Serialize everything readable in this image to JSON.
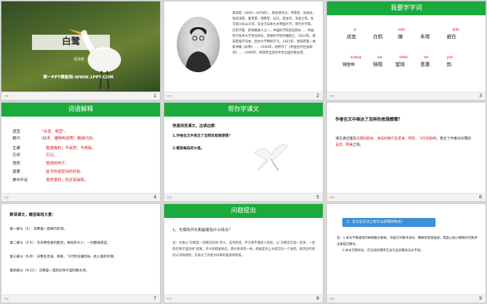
{
  "colors": {
    "accent_green": "#1daa3c",
    "red": "#d2191e",
    "blue": "#3d8fd6"
  },
  "icons": {
    "footer": "slide-play-icon",
    "s1_image": "egret-photo",
    "s2_image": "author-portrait",
    "s5_image": "flying-egret"
  },
  "slides": [
    {
      "num": "1",
      "title": "白鹭",
      "author": "郭沫若",
      "url": "第一PPT模板网-WWW.1PPT.COM"
    },
    {
      "num": "2",
      "bio": "郭沫若（1892—1978年），原名郭开贞，字鼎堂，号尚武，笔名沫若、麦克昂、郭鼎堂、石沱、高汝鸿、羊易之等。生于四川乐山沙湾，毕业于日本九州帝国大学，现代文学家、历史学家、新诗奠基人之一，中国科学院首任院长……中国科学技术大学首任校长，苏联科学院外籍院士。1914年，郭沫若留学日本，因为大学预科学习。1921年，郭沫若第一本新诗集《女神》……1930年，他所写了《中国古代社会研究》……1949年，郭沫若当选为中华全国文联主席。"
    },
    {
      "num": "3",
      "header": "我要学字词",
      "row1": [
        {
          "py": "yí",
          "word": "适宜"
        },
        {
          "py": "",
          "word": "白鹤"
        },
        {
          "py": "xiān",
          "word": "嫌"
        },
        {
          "py": "",
          "word": "朱鹭"
        },
        {
          "py": "qiàn",
          "word": "嵌在"
        }
      ],
      "row2": [
        {
          "py": "kuāng",
          "word": "镜匣框"
        },
        {
          "py": "xié",
          "word": "镜框"
        },
        {
          "py": "shāo",
          "word": "望晓"
        },
        {
          "py": "ēn",
          "word": "恩惠"
        },
        {
          "py": "yùn",
          "word": "韵"
        }
      ]
    },
    {
      "num": "4",
      "header": "词语解释",
      "terms": [
        {
          "t": "适宜",
          "d": "\"合适，相宜\"。"
        },
        {
          "t": "精巧",
          "d": "（技术、器物构造等）精细巧妙。"
        },
        {
          "t": "生硬",
          "d": "勉强做的；不自然；不熟练。"
        },
        {
          "t": "忘却",
          "d": "忘记。"
        },
        {
          "t": "悠然",
          "d": "悠闲的样子。"
        },
        {
          "t": "恩惠",
          "d": "给予的或受到的好处。"
        },
        {
          "t": "美中不足",
          "d": "虽然很好，但还有缺陷。"
        }
      ]
    },
    {
      "num": "5",
      "header": "帮你学课文",
      "lead": "快速浏览课文，边读边想：",
      "q1": "1.作者在文中表达了怎样的思想感情？",
      "q2": "2.概括每段的大意。"
    },
    {
      "num": "6",
      "question": "作者在文中表达了怎样的思想感情？",
      "ans_prefix": "课文通过描写",
      "ans_hl1": "白鹭的颜色、身段的精巧及觅食、照影、飞行的韵味",
      "ans_mid": "，表达了作者对白鹭的",
      "ans_hl2": "喜爱、赞美",
      "ans_end": "之情。"
    },
    {
      "num": "7",
      "lead": "默读课文，概括每段大意：",
      "parts": [
        "第一部分（1）：白鹭是一首精巧的诗。",
        "第二部分（2-5）：写白鹭色素的配合，身段的大小，一切都很适宜。",
        "第三部分（6-8）：白鹭在觅食、照影、飞行时充满韵味，给人美的享受。",
        "第四部分（9-11）：白鹭是一首韵在骨子里的散文诗。"
      ]
    },
    {
      "num": "8",
      "header": "问题提出",
      "q": "1、文章的开头和结尾有什么特点？",
      "a": "答：文章以“白鹭是一首精巧的诗”开头，自然而成，平凡而不落俗人发现。以“白鹭实在是一首诗，一首韵在骨子里的诗”结尾，开头和结尾呼应，使文章浑然一体。结尾是对上文描写的一个总结，既突出作者的认识和感悟，又表达了作者对白鹭的喜爱和赞美。"
    },
    {
      "num": "9",
      "q": "2、本文在写法上有什么鲜明的特点？",
      "a1": "答：1.本文不像通常的咏物散文那样，对描写对象作详尽、细致的客观描述，而是以短小精致的句和手法来描写散文。",
      "a2": "2.本文巧用对比，在比较的用序方法写出白鹭的与众不同。"
    }
  ]
}
